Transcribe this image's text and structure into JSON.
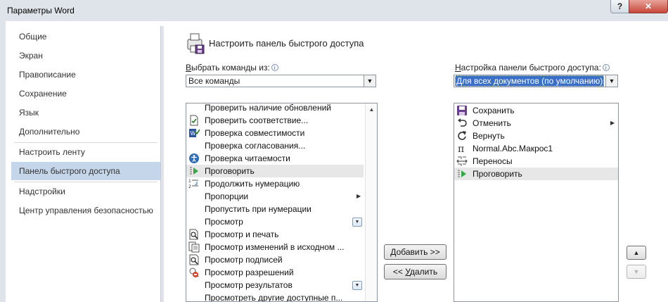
{
  "window": {
    "title": "Параметры Word",
    "help_label": "?",
    "close_label": "✕"
  },
  "nav": {
    "items": [
      {
        "label": "Общие"
      },
      {
        "label": "Экран"
      },
      {
        "label": "Правописание"
      },
      {
        "label": "Сохранение"
      },
      {
        "label": "Язык"
      },
      {
        "label": "Дополнительно"
      },
      {
        "label": "Настроить ленту"
      },
      {
        "label": "Панель быстрого доступа",
        "selected": true
      },
      {
        "label": "Надстройки"
      },
      {
        "label": "Центр управления безопасностью"
      }
    ]
  },
  "header": {
    "title": "Настроить панель быстрого доступа"
  },
  "left": {
    "choose_label_u": "В",
    "choose_label_rest": "ыбрать команды из:",
    "combo_value": "Все команды",
    "commands": [
      {
        "label": "Проверить наличие обновлений",
        "icon": ""
      },
      {
        "label": "Проверить соответствие...",
        "icon": "check-doc-icon"
      },
      {
        "label": "Проверка совместимости",
        "icon": "word-compat-icon"
      },
      {
        "label": "Проверка согласования...",
        "icon": ""
      },
      {
        "label": "Проверка читаемости",
        "icon": "accessibility-icon"
      },
      {
        "label": "Проговорить",
        "icon": "speak-icon",
        "highlighted": true
      },
      {
        "label": "Продолжить нумерацию",
        "icon": "continue-numbering-icon"
      },
      {
        "label": "Пропорции",
        "icon": "",
        "submenu": true
      },
      {
        "label": "Пропустить при нумерации",
        "icon": ""
      },
      {
        "label": "Просмотр",
        "icon": "",
        "dropdown": true
      },
      {
        "label": "Просмотр и печать",
        "icon": "print-preview-icon"
      },
      {
        "label": "Просмотр изменений в исходном ...",
        "icon": "compare-icon"
      },
      {
        "label": "Просмотр подписей",
        "icon": "signatures-icon"
      },
      {
        "label": "Просмотр разрешений",
        "icon": "permissions-icon"
      },
      {
        "label": "Просмотр результатов",
        "icon": "",
        "dropdown": true
      },
      {
        "label": "Просмотреть другие доступные п...",
        "icon": ""
      }
    ]
  },
  "buttons": {
    "add_u": "Д",
    "add_rest": "обавить >>",
    "remove_prefix": "<< ",
    "remove_u": "У",
    "remove_rest": "далить",
    "up": "▲",
    "down": "▼"
  },
  "right": {
    "config_label_u": "Н",
    "config_label_rest": "астройка панели быстрого доступа:",
    "combo_value": "Для всех документов (по умолчанию)",
    "items": [
      {
        "label": "Сохранить",
        "icon": "save-icon"
      },
      {
        "label": "Отменить",
        "icon": "undo-icon",
        "submenu": true
      },
      {
        "label": "Вернуть",
        "icon": "redo-icon"
      },
      {
        "label": "Normal.Abc.Макрос1",
        "icon": "pi-icon"
      },
      {
        "label": "Переносы",
        "icon": "hyphenation-icon"
      },
      {
        "label": "Проговорить",
        "icon": "speak-icon",
        "highlighted": true
      }
    ]
  },
  "colors": {
    "selection": "#c5d5ea",
    "combo_highlight": "#3a70c4",
    "list_highlight": "#e7e7e7"
  }
}
